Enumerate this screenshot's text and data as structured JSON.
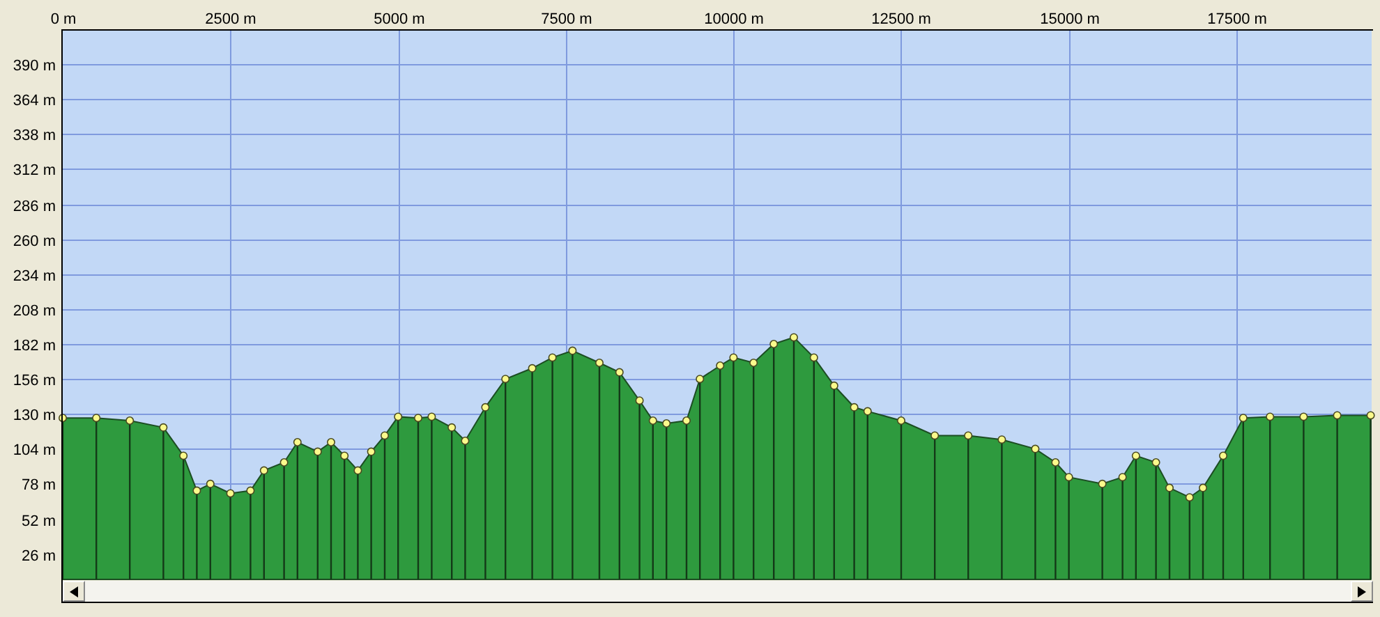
{
  "chart_data": {
    "type": "area",
    "x": [
      0,
      500,
      1000,
      1500,
      1800,
      2000,
      2200,
      2500,
      2800,
      3000,
      3300,
      3500,
      3800,
      4000,
      4200,
      4400,
      4600,
      4800,
      5000,
      5300,
      5500,
      5800,
      6000,
      6300,
      6600,
      7000,
      7300,
      7600,
      8000,
      8300,
      8600,
      8800,
      9000,
      9300,
      9500,
      9800,
      10000,
      10300,
      10600,
      10900,
      11200,
      11500,
      11800,
      12000,
      12500,
      13000,
      13500,
      14000,
      14500,
      14800,
      15000,
      15500,
      15800,
      16000,
      16300,
      16500,
      16800,
      17000,
      17300,
      17600,
      18000,
      18500,
      19000,
      19500
    ],
    "series": [
      {
        "color": "#2e9a3e",
        "values": [
          127,
          127,
          125,
          120,
          99,
          73,
          78,
          71,
          73,
          88,
          94,
          109,
          102,
          109,
          99,
          88,
          102,
          114,
          128,
          127,
          128,
          120,
          110,
          135,
          156,
          164,
          172,
          177,
          168,
          161,
          140,
          125,
          123,
          125,
          156,
          166,
          172,
          168,
          182,
          187,
          172,
          151,
          135,
          132,
          125,
          114,
          114,
          111,
          104,
          94,
          83,
          78,
          83,
          99,
          94,
          75,
          68,
          75,
          99,
          127,
          128,
          128,
          129,
          129
        ]
      }
    ],
    "grid": true,
    "xlim": [
      0,
      19514
    ],
    "ylim": [
      7,
      415
    ],
    "xticks": [
      {
        "value": 0,
        "label": "0 m"
      },
      {
        "value": 2500,
        "label": "2500 m"
      },
      {
        "value": 5000,
        "label": "5000 m"
      },
      {
        "value": 7500,
        "label": "7500 m"
      },
      {
        "value": 10000,
        "label": "10000 m"
      },
      {
        "value": 12500,
        "label": "12500 m"
      },
      {
        "value": 15000,
        "label": "15000 m"
      },
      {
        "value": 17500,
        "label": "17500 m"
      }
    ],
    "yticks": [
      {
        "value": 26,
        "label": "26 m"
      },
      {
        "value": 52,
        "label": "52 m"
      },
      {
        "value": 78,
        "label": "78 m"
      },
      {
        "value": 104,
        "label": "104 m"
      },
      {
        "value": 130,
        "label": "130 m"
      },
      {
        "value": 156,
        "label": "156 m"
      },
      {
        "value": 182,
        "label": "182 m"
      },
      {
        "value": 208,
        "label": "208 m"
      },
      {
        "value": 234,
        "label": "234 m"
      },
      {
        "value": 260,
        "label": "260 m"
      },
      {
        "value": 286,
        "label": "286 m"
      },
      {
        "value": 312,
        "label": "312 m"
      },
      {
        "value": 338,
        "label": "338 m"
      },
      {
        "value": 364,
        "label": "364 m"
      },
      {
        "value": 390,
        "label": "390 m"
      }
    ]
  }
}
